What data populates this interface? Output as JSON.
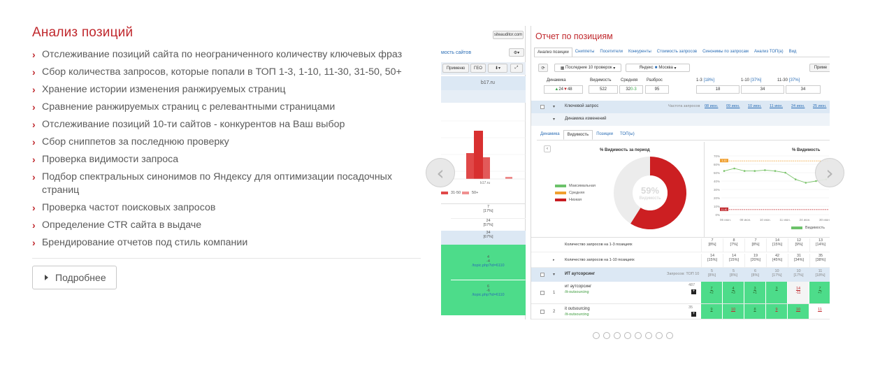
{
  "section": {
    "title": "Анализ позиций",
    "features": [
      "Отслеживание позиций сайта по неограниченного количеству ключевых фраз",
      "Сбор количества запросов, которые попали в ТОП 1-3, 1-10, 11-30, 31-50, 50+",
      "Хранение истории изменения ранжируемых страниц",
      "Сравнение ранжируемых страниц с релевантными страницами",
      "Отслеживание позиций 10-ти сайтов - конкурентов на Ваш выбор",
      "Сбор сниппетов за последнюю проверку",
      "Проверка видимости запроса",
      "Подбор спектральных синонимов по Яндексу для оптимизации посадочных страниц",
      "Проверка частот поисковых запросов",
      "Определение CTR сайта в выдаче",
      "Брендирование отчетов под стиль компании"
    ],
    "more_label": "Подробнее"
  },
  "slider": {
    "prev_glyph": "‹",
    "next_glyph": "›",
    "dot_count": 8,
    "slide_a": {
      "badge": "siteauditor.com",
      "link_text": "мость сайтов",
      "btn_apply": "Применю",
      "btn_geo": "ГЕО",
      "domain": "b17.ru",
      "bar_label": "b17.ru",
      "legend_1": "31-50",
      "legend_2": "50+",
      "cells": [
        {
          "v1": "7",
          "v2": "[17%]"
        },
        {
          "v1": "24",
          "v2": "[57%]"
        },
        {
          "v1": "34",
          "v2": "[67%]"
        }
      ],
      "green_cells": [
        {
          "v1": "4",
          "v2": "-4",
          "url": "/topic.php?id=6110"
        },
        {
          "v1": "6",
          "v2": "-6",
          "url": "/topic.php?id=6110"
        }
      ]
    },
    "slide_b": {
      "title": "Отчет по позициям",
      "tabs": [
        "Анализ позиции",
        "Сниппеты",
        "Посетители",
        "Конкуренты",
        "Стоимость запросов",
        "Синонимы по запросам",
        "Анализ ТОП(а)",
        "Вид"
      ],
      "toolbar": {
        "period": "Последние 10 проверок",
        "engine": "Яндекс",
        "region": "Москва",
        "right_btn": "Приме"
      },
      "stats_headers": [
        "Динамика",
        "Видимость",
        "Средняя",
        "Разброс",
        "1-3",
        "1-10",
        "11-30"
      ],
      "stats_header_pcts": [
        "",
        "",
        "",
        "",
        "[18%]",
        "[37%]",
        "[37%]"
      ],
      "stats_values": {
        "dyn_up": "24",
        "dyn_down": "48",
        "visibility": "522",
        "avg": "32",
        "avg_delta": "0-3",
        "spread": "95",
        "top3": "18",
        "top10": "34",
        "top30": "34"
      },
      "keyword_header": "Ключевой запрос",
      "freq_header": "Частота запросов",
      "date_headers": [
        "08 июн.",
        "09 июн.",
        "10 июн.",
        "11 июн.",
        "24 июн.",
        "25 июн."
      ],
      "dynamics_row": "Динамика изменений",
      "subtabs": [
        "Динамика",
        "Видимость",
        "Позиции",
        "ТОП(ы)"
      ],
      "donut": {
        "title": "% Видимость за период",
        "percent": 59,
        "percent_label": "59%",
        "center_sub": "Видимость",
        "legend": [
          {
            "label": "Максимальная",
            "color": "#6cc26a"
          },
          {
            "label": "Средняя",
            "color": "#f0a030"
          },
          {
            "label": "Низкая",
            "color": "#c81d22"
          }
        ],
        "filled_color": "#cc1f22",
        "empty_color": "#ececec"
      },
      "line_chart": {
        "title": "% Видимость",
        "y_ticks": [
          "70%",
          "60%",
          "50%",
          "40%",
          "30%",
          "20%",
          "10%",
          "0%"
        ],
        "x_ticks": [
          "06 июн.",
          "08 июн.",
          "10 июн.",
          "11 июн.",
          "24 июн.",
          "30 июн."
        ],
        "legend": "Видимость",
        "tag_top": "1-10",
        "tag_bottom": "11-40",
        "values": [
          52,
          55,
          52,
          52,
          53,
          52,
          50,
          42,
          38,
          40,
          42
        ]
      },
      "summary_rows": [
        {
          "label": "Количество запросов на 1-3 позициях",
          "cells": [
            [
              "7",
              "[8%]"
            ],
            [
              "8",
              "[7%]"
            ],
            [
              "7",
              "[8%]"
            ],
            [
              "14",
              "[15%]"
            ],
            [
              "12",
              "[9%]"
            ],
            [
              "13",
              "[14%]"
            ]
          ]
        },
        {
          "label": "Количество запросов на 1-10 позициях",
          "cells": [
            [
              "14",
              "[15%]"
            ],
            [
              "14",
              "[15%]"
            ],
            [
              "19",
              "[20%]"
            ],
            [
              "42",
              "[45%]"
            ],
            [
              "31",
              "[34%]"
            ],
            [
              "35",
              "[38%]"
            ]
          ]
        }
      ],
      "group_row": {
        "label": "ИТ аутсорсинг",
        "right": "Запросов: ТОП 10",
        "cells": [
          [
            "5",
            "[8%]"
          ],
          [
            "5",
            "[8%]"
          ],
          [
            "6",
            "[8%]"
          ],
          [
            "10",
            "[17%]"
          ],
          [
            "10",
            "[17%]"
          ],
          [
            "11",
            "[18%]"
          ]
        ]
      },
      "keyword_rows": [
        {
          "idx": "1",
          "name": "ит аутсорсинг",
          "url": "/it-outsourcing",
          "freq": "487",
          "cells": [
            [
              "7",
              "+2"
            ],
            [
              "4",
              "+3"
            ],
            [
              "3",
              "+1"
            ],
            [
              "3",
              ""
            ],
            [
              "14",
              "-11"
            ],
            [
              "7",
              "+7"
            ]
          ],
          "red": [
            false,
            false,
            false,
            false,
            true,
            false
          ]
        },
        {
          "idx": "2",
          "name": "it outsourcing",
          "url": "/it-outsourcing",
          "freq": "35",
          "cells": [
            [
              "9",
              ""
            ],
            [
              "10",
              ""
            ],
            [
              "8",
              ""
            ],
            [
              "9",
              ""
            ],
            [
              "10",
              ""
            ],
            [
              "11",
              ""
            ]
          ],
          "red": [
            false,
            true,
            false,
            true,
            true,
            true
          ]
        }
      ]
    }
  }
}
